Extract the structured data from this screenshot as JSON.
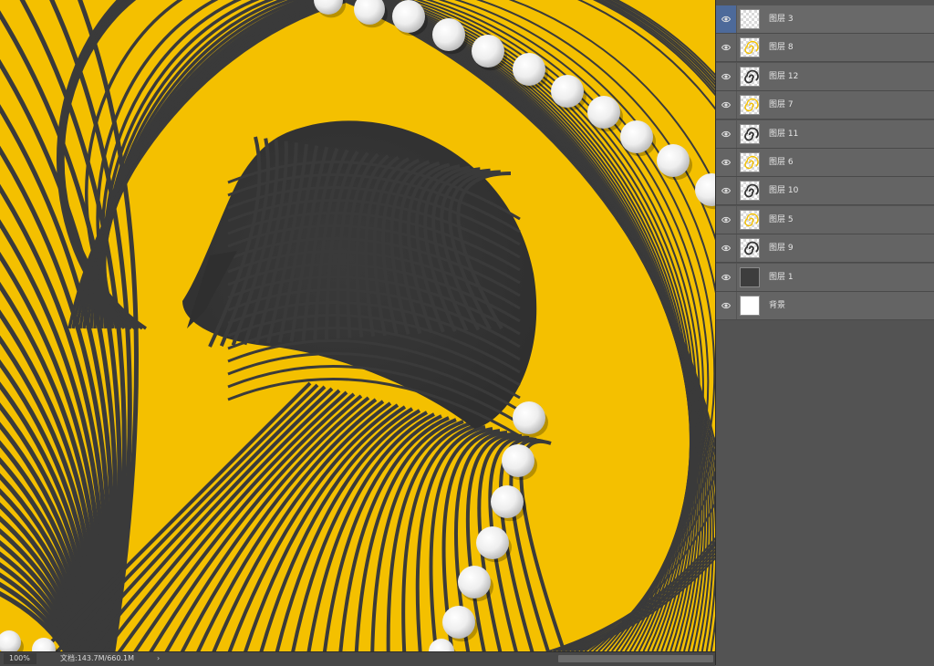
{
  "status_bar": {
    "zoom": "100%",
    "doc_info": "文档:143.7M/660.1M",
    "arrow": "›"
  },
  "layers": [
    {
      "name": "图层 3",
      "thumb": "transparent",
      "selected": true
    },
    {
      "name": "图层 8",
      "thumb": "swirl-yellow"
    },
    {
      "name": "图层 12",
      "thumb": "swirl-dark"
    },
    {
      "name": "图层 7",
      "thumb": "swirl-yellow"
    },
    {
      "name": "图层 11",
      "thumb": "swirl-dark"
    },
    {
      "name": "图层 6",
      "thumb": "swirl-yellow"
    },
    {
      "name": "图层 10",
      "thumb": "swirl-dark"
    },
    {
      "name": "图层 5",
      "thumb": "swirl-yellow"
    },
    {
      "name": "图层 9",
      "thumb": "swirl-dark"
    },
    {
      "name": "图层 1",
      "thumb": "solid-dark"
    },
    {
      "name": "背景",
      "thumb": "solid-white"
    }
  ],
  "colors": {
    "artwork_yellow": "#f4c000",
    "artwork_dark": "#3a3a3a",
    "pearl": "#f2f2f2",
    "selected_eye": "#4d6a9a"
  }
}
